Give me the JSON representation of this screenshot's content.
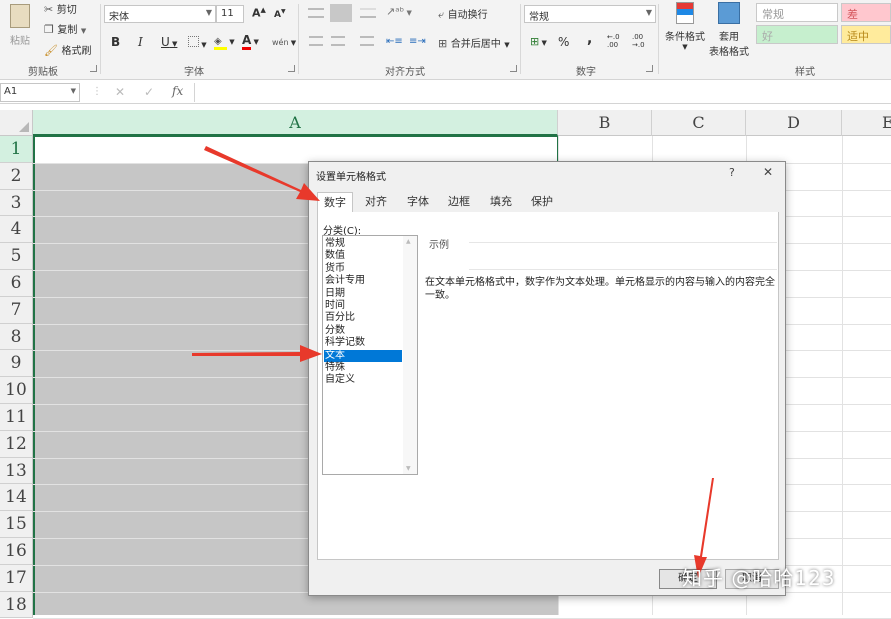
{
  "ribbon": {
    "clipboard": {
      "paste": "粘贴",
      "cut": "剪切",
      "copy": "复制",
      "format_painter": "格式刷",
      "group_label": "剪贴板"
    },
    "font": {
      "font_name": "宋体",
      "font_size": "11",
      "group_label": "字体",
      "bold": "B",
      "italic": "I",
      "underline": "U",
      "grow": "A",
      "shrink": "A",
      "font_color_icon": "A",
      "phonetic": "wén"
    },
    "alignment": {
      "wrap_text": "自动换行",
      "merge_center": "合并后居中",
      "group_label": "对齐方式"
    },
    "number": {
      "format": "常规",
      "percent": "%",
      "comma": ",",
      "inc_decimal": "←.0 .00",
      "dec_decimal": ".00 →.0",
      "group_label": "数字"
    },
    "styles": {
      "conditional": "条件格式",
      "table_format_1": "套用",
      "table_format_2": "表格格式",
      "normal": "常规",
      "bad": "差",
      "good": "好",
      "neutral": "适中",
      "group_label": "样式"
    }
  },
  "formula_bar": {
    "name_box": "A1",
    "cancel": "✕",
    "enter": "✓",
    "fx": "fx",
    "value": ""
  },
  "grid": {
    "columns": [
      "A",
      "B",
      "C",
      "D",
      "E"
    ],
    "rows": [
      "1",
      "2",
      "3",
      "4",
      "5",
      "6",
      "7",
      "8",
      "9",
      "10",
      "11",
      "12",
      "13",
      "14",
      "15",
      "16",
      "17",
      "18"
    ]
  },
  "dialog": {
    "title": "设置单元格格式",
    "help": "?",
    "close": "✕",
    "tabs": [
      "数字",
      "对齐",
      "字体",
      "边框",
      "填充",
      "保护"
    ],
    "category_label": "分类(C):",
    "categories": [
      "常规",
      "数值",
      "货币",
      "会计专用",
      "日期",
      "时间",
      "百分比",
      "分数",
      "科学记数",
      "文本",
      "特殊",
      "自定义"
    ],
    "selected_category": "文本",
    "sample_label": "示例",
    "description": "在文本单元格格式中，数字作为文本处理。单元格显示的内容与输入的内容完全一致。",
    "ok": "确定",
    "cancel": "取消"
  },
  "watermark": "知乎 @哈哈123",
  "colors": {
    "accent": "#0078d7",
    "arrow": "#e8392b",
    "selected_col_header": "#d3f0e0",
    "selected_range": "#c6c6c6"
  }
}
